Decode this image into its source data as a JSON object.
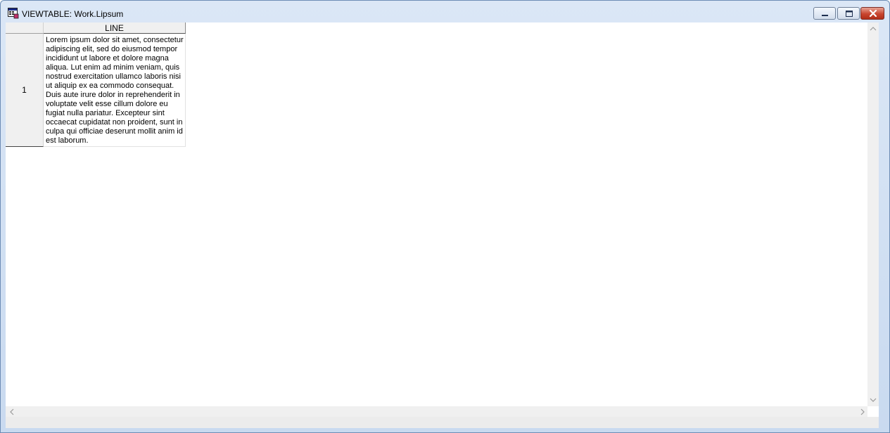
{
  "window": {
    "title": "VIEWTABLE: Work.Lipsum"
  },
  "table": {
    "columns": [
      "LINE"
    ],
    "rows": [
      {
        "number": "1",
        "line": "Lorem ipsum dolor sit amet, consectetur adipiscing elit, sed do eiusmod tempor incididunt ut labore et dolore magna aliqua. Lut enim ad minim veniam, quis nostrud exercitation ullamco laboris nisi ut aliquip ex ea commodo consequat. Duis aute irure dolor in reprehenderit in voluptate velit esse cillum dolore eu fugiat nulla pariatur. Excepteur sint occaecat cupidatat non proident, sunt in culpa qui officiae deserunt mollit anim id est laborum."
      }
    ]
  },
  "icons": {
    "app": "viewtable-icon",
    "minimize": "minimize-icon",
    "maximize": "maximize-icon",
    "close": "close-icon",
    "scroll_up": "chevron-up-icon",
    "scroll_down": "chevron-down-icon",
    "scroll_left": "chevron-left-icon",
    "scroll_right": "chevron-right-icon"
  },
  "colors": {
    "title_bar": "#d3e1f3",
    "close_button": "#c8452f",
    "header_bg": "#f0f0f0"
  }
}
